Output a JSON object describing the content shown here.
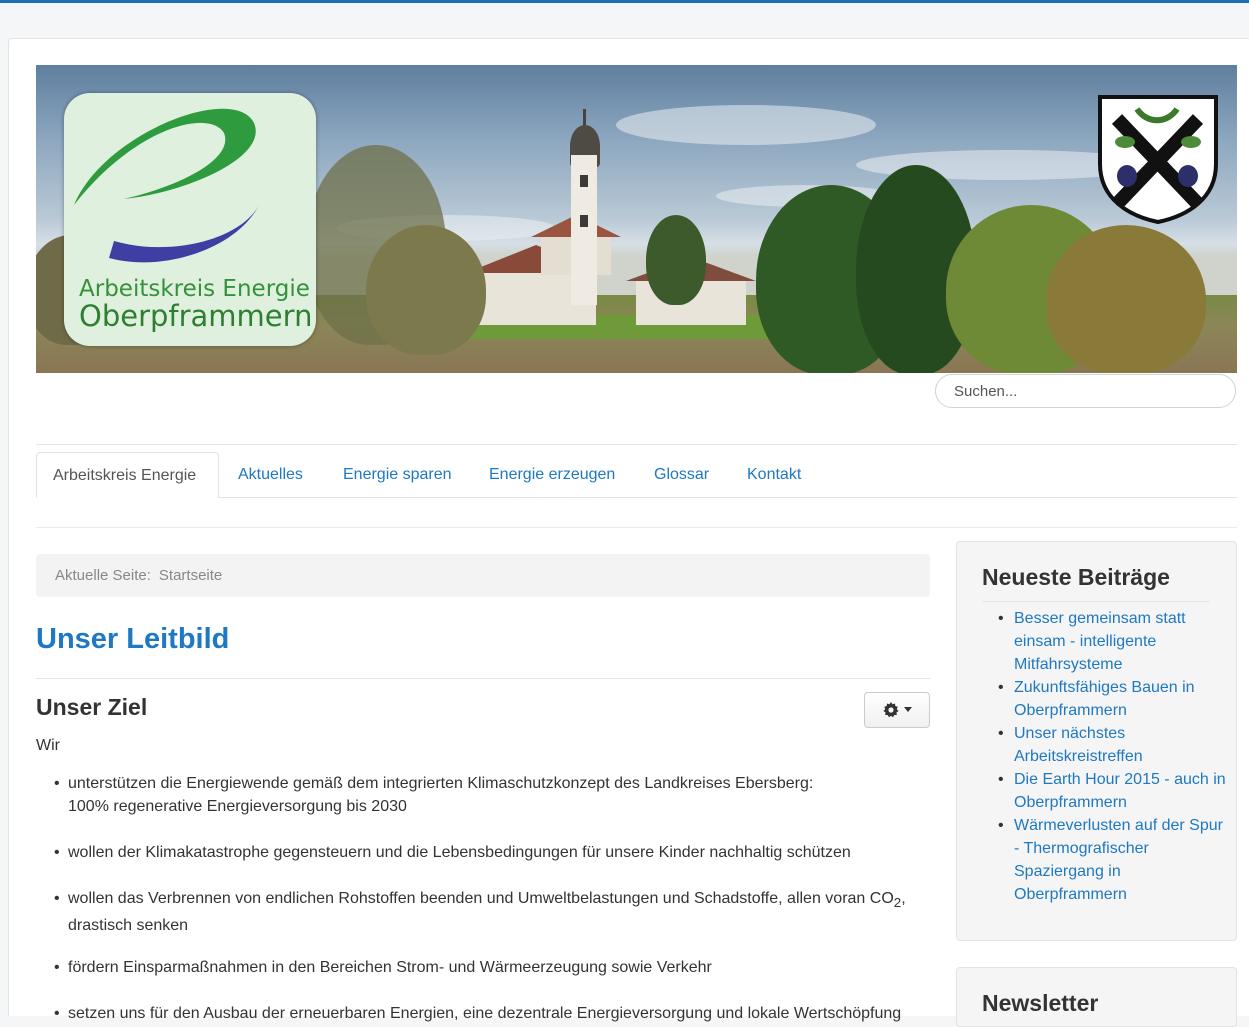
{
  "header": {
    "logo_line1": "Arbeitskreis Energie",
    "logo_line2": "Oberpframmern",
    "accent_color": "#1e78c2",
    "logo_green": "#35913a"
  },
  "search": {
    "placeholder": "Suchen..."
  },
  "nav": {
    "tabs": [
      {
        "label": "Arbeitskreis Energie",
        "active": true
      },
      {
        "label": "Aktuelles",
        "active": false
      },
      {
        "label": "Energie sparen",
        "active": false
      },
      {
        "label": "Energie erzeugen",
        "active": false
      },
      {
        "label": "Glossar",
        "active": false
      },
      {
        "label": "Kontakt",
        "active": false
      }
    ]
  },
  "breadcrumb": {
    "prefix": "Aktuelle Seite:",
    "current": "Startseite"
  },
  "main": {
    "title": "Unser Leitbild",
    "subtitle": "Unser Ziel",
    "intro": "Wir",
    "bullets": [
      {
        "line1": "unterstützen die Energiewende gemäß dem integrierten Klimaschutzkonzept des Landkreises Ebersberg:",
        "line2": "100% regenerative Energieversorgung bis 2030"
      },
      {
        "line1": "wollen der Klimakatastrophe gegensteuern und die Lebensbedingungen für unsere Kinder nachhaltig schützen",
        "line2": ""
      },
      {
        "line1": "wollen das Verbrennen von endlichen Rohstoffen beenden und Umweltbelastungen und Schadstoffe, allen voran CO",
        "sub": "2",
        "line1_end": ",",
        "line2": "drastisch senken"
      },
      {
        "line1": "fördern Einsparmaßnahmen in den Bereichen Strom- und Wärmeerzeugung sowie Verkehr",
        "line2": ""
      },
      {
        "line1": "setzen uns für den Ausbau der erneuerbaren Energien, eine dezentrale Energieversorgung und lokale Wertschöpfung",
        "line2": ""
      }
    ]
  },
  "sidebar": {
    "latest_title": "Neueste Beiträge",
    "latest_items": [
      "Besser gemeinsam statt einsam - intelligente Mitfahrsysteme",
      "Zukunftsfähiges Bauen in Oberpframmern",
      "Unser nächstes Arbeitskreistreffen",
      "Die Earth Hour 2015 - auch in Oberpframmern",
      "Wärmeverlusten auf der Spur - Thermografischer Spaziergang in Oberpframmern"
    ],
    "newsletter_title": "Newsletter"
  }
}
